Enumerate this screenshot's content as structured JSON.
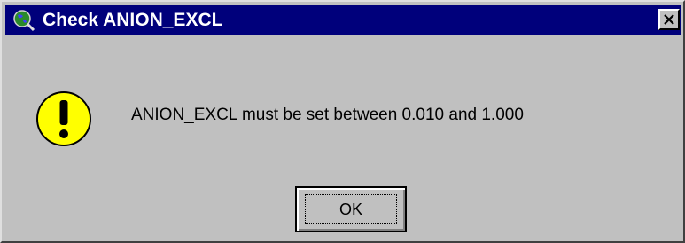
{
  "window": {
    "title": "Check ANION_EXCL",
    "icon": "globe-magnifier-icon",
    "close_label": "×"
  },
  "dialog": {
    "icon": "exclamation-warning-icon",
    "message": "ANION_EXCL must be set between 0.010 and 1.000",
    "ok_label": "OK"
  },
  "colors": {
    "titlebar": "#00007b",
    "face": "#c0c0c0",
    "warning_fill": "#ffff00"
  }
}
